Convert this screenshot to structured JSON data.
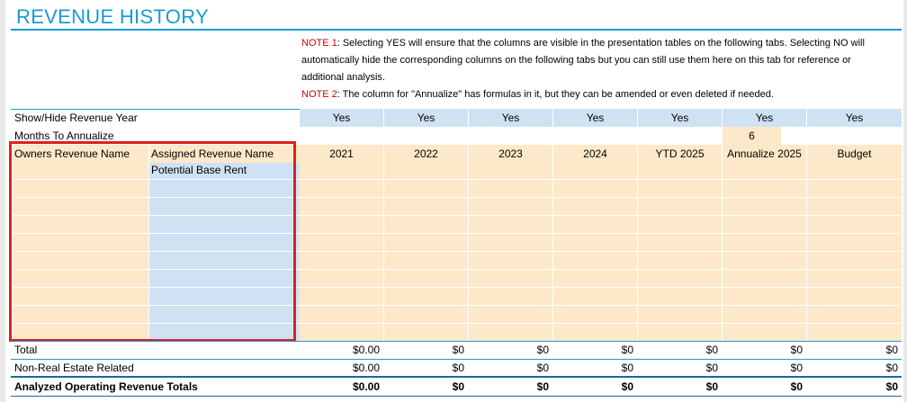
{
  "title": "REVENUE HISTORY",
  "notes": {
    "note1_label": "NOTE 1",
    "note1_text": ": Selecting YES will ensure that the columns are visible in the presentation tables on the following tabs. Selecting NO will automatically hide the corresponding columns on the following tabs but you can still use them here on this tab for reference or additional analysis.",
    "note2_label": "NOTE 2",
    "note2_text": ": The column for \"Annualize\" has formulas in it, but they can be amended or even deleted if needed."
  },
  "rows": {
    "show_hide_label": "Show/Hide Revenue Year",
    "show_hide_values": [
      "Yes",
      "Yes",
      "Yes",
      "Yes",
      "Yes",
      "Yes",
      "Yes"
    ],
    "months_label": "Months To Annualize",
    "months_value": "6",
    "owners_header": "Owners Revenue Name",
    "assigned_header": "Assigned Revenue Name",
    "column_headers": [
      "2021",
      "2022",
      "2023",
      "2024",
      "YTD 2025",
      "Annualize 2025",
      "Budget"
    ],
    "assigned_first": "Potential Base Rent"
  },
  "totals": {
    "total_label": "Total",
    "total_values": [
      "$0.00",
      "$0",
      "$0",
      "$0",
      "$0",
      "$0",
      "$0"
    ],
    "non_re_label": "Non-Real Estate Related",
    "non_re_values": [
      "$0.00",
      "$0",
      "$0",
      "$0",
      "$0",
      "$0",
      "$0"
    ],
    "analyzed_label": "Analyzed Operating Revenue Totals",
    "analyzed_values": [
      "$0.00",
      "$0",
      "$0",
      "$0",
      "$0",
      "$0",
      "$0"
    ]
  },
  "colors": {
    "accent": "#1a9ad6",
    "note_red": "#d00000",
    "input_blue": "#cfe2f3",
    "input_peach": "#fde9c9",
    "highlight_box": "#e02020"
  }
}
